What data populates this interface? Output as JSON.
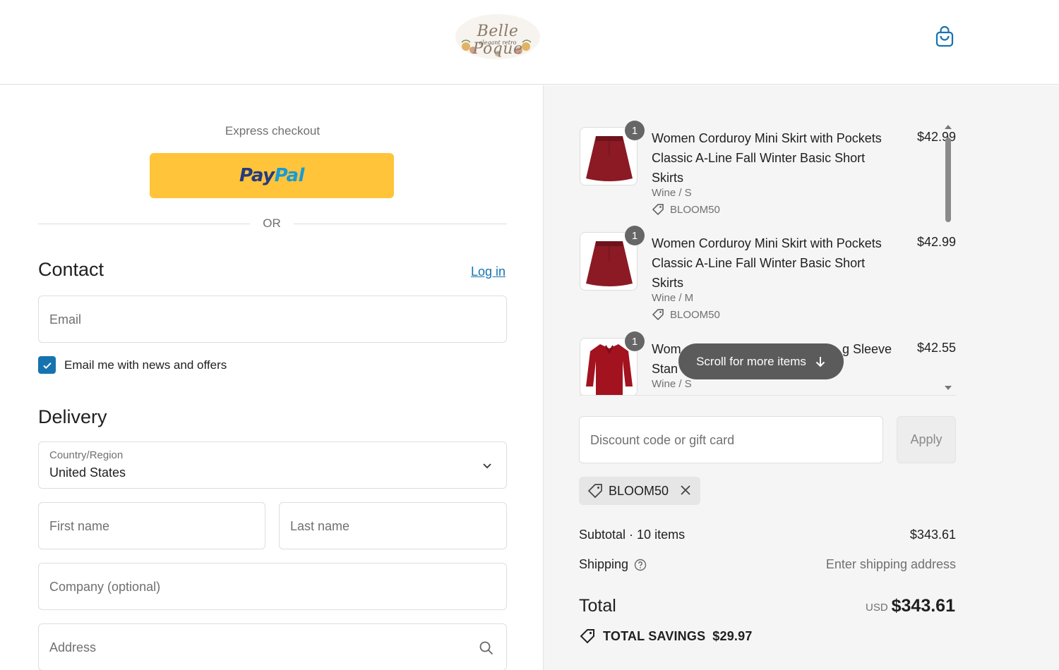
{
  "header": {
    "logo": {
      "script": "Belle Poque",
      "sub": "elegant retro"
    }
  },
  "express": {
    "label": "Express checkout",
    "paypal_pay": "Pay",
    "paypal_pal": "Pal",
    "or": "OR"
  },
  "contact": {
    "title": "Contact",
    "login": "Log in",
    "email_placeholder": "Email",
    "newsletter_label": "Email me with news and offers",
    "newsletter_checked": true
  },
  "delivery": {
    "title": "Delivery",
    "country_label": "Country/Region",
    "country_value": "United States",
    "first_name_placeholder": "First name",
    "last_name_placeholder": "Last name",
    "company_placeholder": "Company (optional)",
    "address_placeholder": "Address"
  },
  "cart": {
    "items": [
      {
        "qty": "1",
        "name": "Women Corduroy Mini Skirt with Pockets Classic A-Line Fall Winter Basic Short Skirts",
        "variant": "Wine / S",
        "code": "BLOOM50",
        "price": "$42.99",
        "image": "skirt"
      },
      {
        "qty": "1",
        "name": "Women Corduroy Mini Skirt with Pockets Classic A-Line Fall Winter Basic Short Skirts",
        "variant": "Wine / M",
        "code": "BLOOM50",
        "price": "$42.99",
        "image": "skirt"
      },
      {
        "qty": "1",
        "name_line1_start": "Wom",
        "name_line1_end": "g Sleeve",
        "name_line2_start": "Stan",
        "variant": "Wine / S",
        "price": "$42.55",
        "image": "blouse"
      }
    ],
    "scroll_hint": "Scroll for more items",
    "discount_placeholder": "Discount code or gift card",
    "apply": "Apply",
    "applied_code": "BLOOM50"
  },
  "summary": {
    "subtotal_label": "Subtotal · 10 items",
    "subtotal_value": "$343.61",
    "shipping_label": "Shipping",
    "shipping_value": "Enter shipping address",
    "total_label": "Total",
    "currency": "USD",
    "total_value": "$343.61",
    "savings_label": "TOTAL SAVINGS",
    "savings_value": "$29.97"
  },
  "colors": {
    "accent": "#1773b0",
    "paypal_yellow": "#ffc439",
    "product_wine": "#8b1a24"
  },
  "icons": [
    "shopping-bag-icon",
    "checkbox-check-icon",
    "chevron-down-icon",
    "search-icon",
    "tag-icon",
    "arrow-down-icon",
    "close-icon",
    "help-circle-icon",
    "savings-tag-icon"
  ]
}
